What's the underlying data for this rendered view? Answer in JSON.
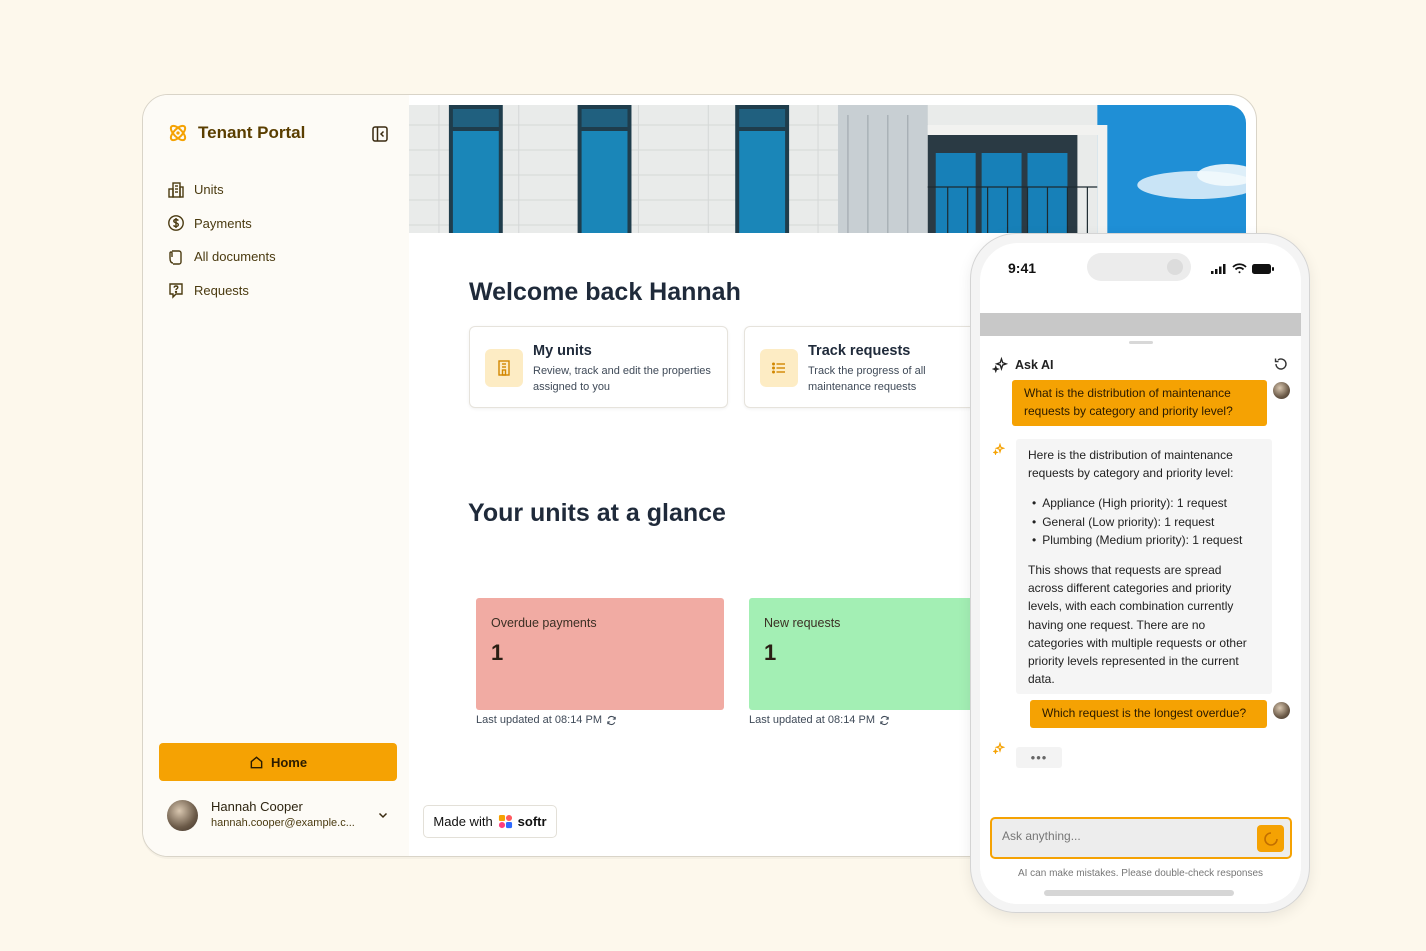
{
  "brand": {
    "title": "Tenant Portal",
    "color": "#f5a203"
  },
  "sidebar": {
    "items": [
      {
        "label": "Units",
        "icon": "building-icon"
      },
      {
        "label": "Payments",
        "icon": "dollar-circle-icon"
      },
      {
        "label": "All documents",
        "icon": "document-hand-icon"
      },
      {
        "label": "Requests",
        "icon": "question-bubble-icon"
      }
    ],
    "home_label": "Home",
    "user": {
      "name": "Hannah Cooper",
      "email": "hannah.cooper@example.c..."
    }
  },
  "main": {
    "welcome": "Welcome back Hannah",
    "cards": [
      {
        "title": "My units",
        "desc": "Review, track and edit the properties assigned to you",
        "icon": "building-icon"
      },
      {
        "title": "Track requests",
        "desc": "Track the progress of all maintenance requests",
        "icon": "list-icon"
      }
    ],
    "glance_title": "Your units at a glance",
    "stats": [
      {
        "label": "Overdue payments",
        "value": "1",
        "updated": "Last updated at 08:14 PM",
        "color": "#f1aba3"
      },
      {
        "label": "New requests",
        "value": "1",
        "updated": "Last updated at 08:14 PM",
        "color": "#a3efb4"
      }
    ],
    "made_with": "Made with",
    "made_with_brand": "softr"
  },
  "phone": {
    "time": "9:41",
    "chat_title": "Ask AI",
    "messages": [
      {
        "role": "user",
        "text": "What is the distribution of maintenance requests by category and priority level?"
      },
      {
        "role": "assistant",
        "intro": "Here is the distribution of maintenance requests by category and priority level:",
        "bullets": [
          "Appliance (High priority): 1 request",
          "General (Low priority): 1 request",
          "Plumbing (Medium priority): 1 request"
        ],
        "outro": "This shows that requests are spread across different categories and priority levels, with each combination currently having one request. There are no categories with multiple requests or other priority levels represented in the current data."
      },
      {
        "role": "user",
        "text": "Which request is the longest overdue?"
      }
    ],
    "typing": "•••",
    "input_placeholder": "Ask anything...",
    "disclaimer": "AI can make mistakes. Please double-check responses"
  }
}
